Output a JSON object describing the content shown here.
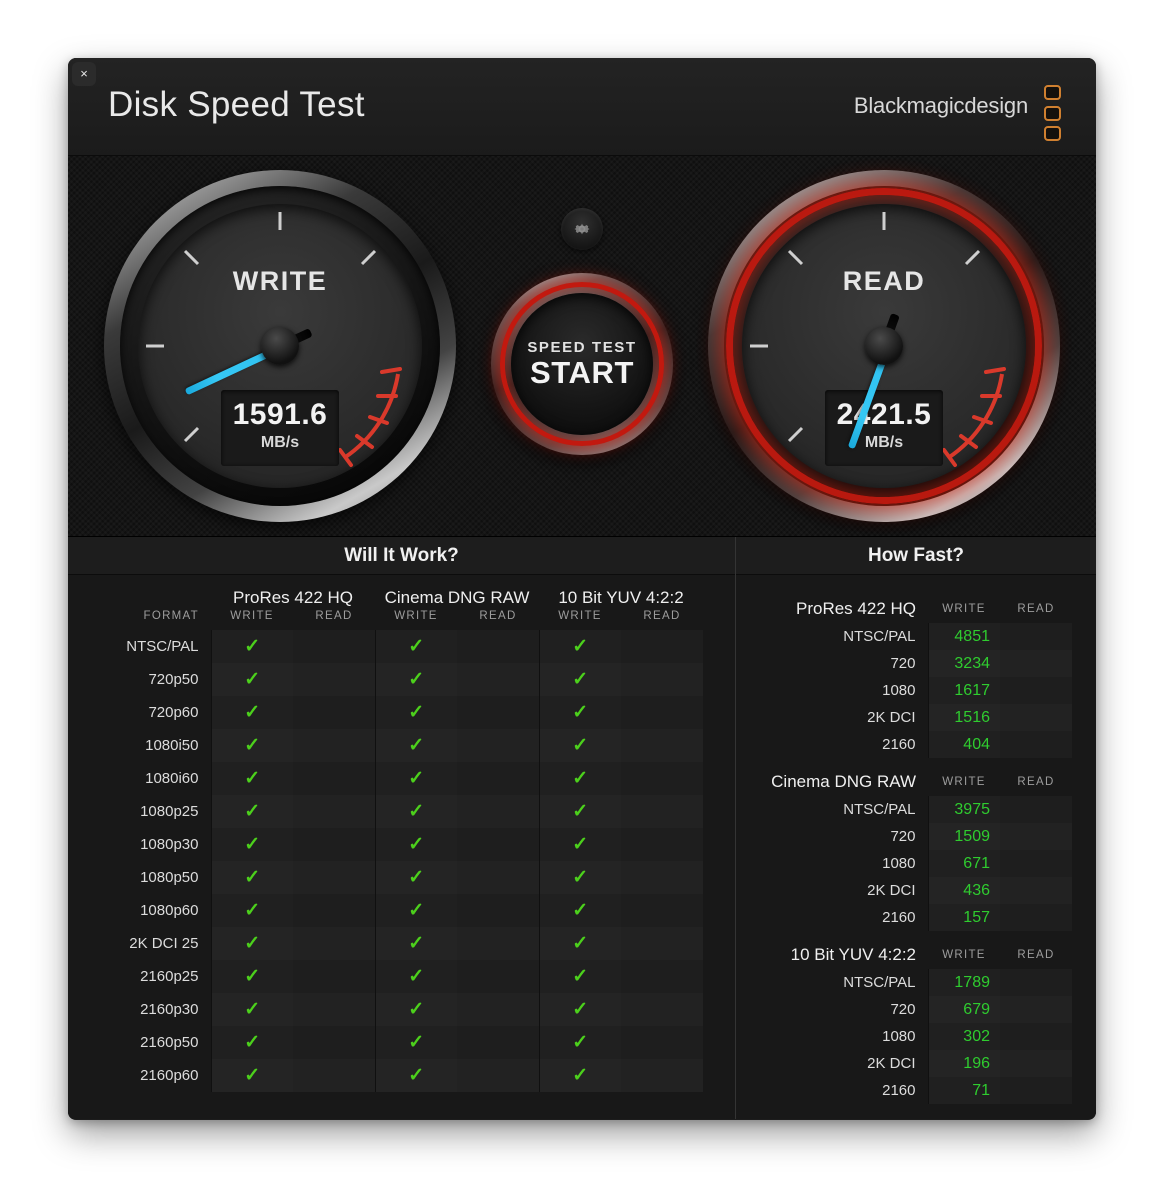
{
  "window": {
    "close_label": "×",
    "title": "Disk Speed Test",
    "brand": "Blackmagicdesign"
  },
  "gauges": {
    "write": {
      "label": "WRITE",
      "value": "1591.6",
      "unit": "MB/s",
      "needle_angle": -205
    },
    "read": {
      "label": "READ",
      "value": "2421.5",
      "unit": "MB/s",
      "needle_angle": -250
    }
  },
  "center": {
    "gear_icon": "gear-icon",
    "start_small": "SPEED TEST",
    "start_big": "START"
  },
  "will_it_work": {
    "title": "Will It Work?",
    "format_header": "FORMAT",
    "groups": [
      "ProRes 422 HQ",
      "Cinema DNG RAW",
      "10 Bit YUV 4:2:2"
    ],
    "sub_headers": [
      "WRITE",
      "READ"
    ],
    "check_glyph": "✓",
    "rows": [
      {
        "format": "NTSC/PAL",
        "write": [
          true,
          true,
          true
        ],
        "read": [
          false,
          false,
          false
        ]
      },
      {
        "format": "720p50",
        "write": [
          true,
          true,
          true
        ],
        "read": [
          false,
          false,
          false
        ]
      },
      {
        "format": "720p60",
        "write": [
          true,
          true,
          true
        ],
        "read": [
          false,
          false,
          false
        ]
      },
      {
        "format": "1080i50",
        "write": [
          true,
          true,
          true
        ],
        "read": [
          false,
          false,
          false
        ]
      },
      {
        "format": "1080i60",
        "write": [
          true,
          true,
          true
        ],
        "read": [
          false,
          false,
          false
        ]
      },
      {
        "format": "1080p25",
        "write": [
          true,
          true,
          true
        ],
        "read": [
          false,
          false,
          false
        ]
      },
      {
        "format": "1080p30",
        "write": [
          true,
          true,
          true
        ],
        "read": [
          false,
          false,
          false
        ]
      },
      {
        "format": "1080p50",
        "write": [
          true,
          true,
          true
        ],
        "read": [
          false,
          false,
          false
        ]
      },
      {
        "format": "1080p60",
        "write": [
          true,
          true,
          true
        ],
        "read": [
          false,
          false,
          false
        ]
      },
      {
        "format": "2K DCI 25",
        "write": [
          true,
          true,
          true
        ],
        "read": [
          false,
          false,
          false
        ]
      },
      {
        "format": "2160p25",
        "write": [
          true,
          true,
          true
        ],
        "read": [
          false,
          false,
          false
        ]
      },
      {
        "format": "2160p30",
        "write": [
          true,
          true,
          true
        ],
        "read": [
          false,
          false,
          false
        ]
      },
      {
        "format": "2160p50",
        "write": [
          true,
          true,
          true
        ],
        "read": [
          false,
          false,
          false
        ]
      },
      {
        "format": "2160p60",
        "write": [
          true,
          true,
          true
        ],
        "read": [
          false,
          false,
          false
        ]
      }
    ]
  },
  "how_fast": {
    "title": "How Fast?",
    "sub_headers": [
      "WRITE",
      "READ"
    ],
    "groups": [
      {
        "name": "ProRes 422 HQ",
        "rows": [
          {
            "label": "NTSC/PAL",
            "write": "4851",
            "read": ""
          },
          {
            "label": "720",
            "write": "3234",
            "read": ""
          },
          {
            "label": "1080",
            "write": "1617",
            "read": ""
          },
          {
            "label": "2K DCI",
            "write": "1516",
            "read": ""
          },
          {
            "label": "2160",
            "write": "404",
            "read": ""
          }
        ]
      },
      {
        "name": "Cinema DNG RAW",
        "rows": [
          {
            "label": "NTSC/PAL",
            "write": "3975",
            "read": ""
          },
          {
            "label": "720",
            "write": "1509",
            "read": ""
          },
          {
            "label": "1080",
            "write": "671",
            "read": ""
          },
          {
            "label": "2K DCI",
            "write": "436",
            "read": ""
          },
          {
            "label": "2160",
            "write": "157",
            "read": ""
          }
        ]
      },
      {
        "name": "10 Bit YUV 4:2:2",
        "rows": [
          {
            "label": "NTSC/PAL",
            "write": "1789",
            "read": ""
          },
          {
            "label": "720",
            "write": "679",
            "read": ""
          },
          {
            "label": "1080",
            "write": "302",
            "read": ""
          },
          {
            "label": "2K DCI",
            "write": "196",
            "read": ""
          },
          {
            "label": "2160",
            "write": "71",
            "read": ""
          }
        ]
      }
    ]
  },
  "colors": {
    "accent_red": "#c2190f",
    "needle_blue": "#36c8f5",
    "check_green": "#4cd01c",
    "value_green": "#2fcc2f",
    "brand_orange": "#d08030"
  }
}
